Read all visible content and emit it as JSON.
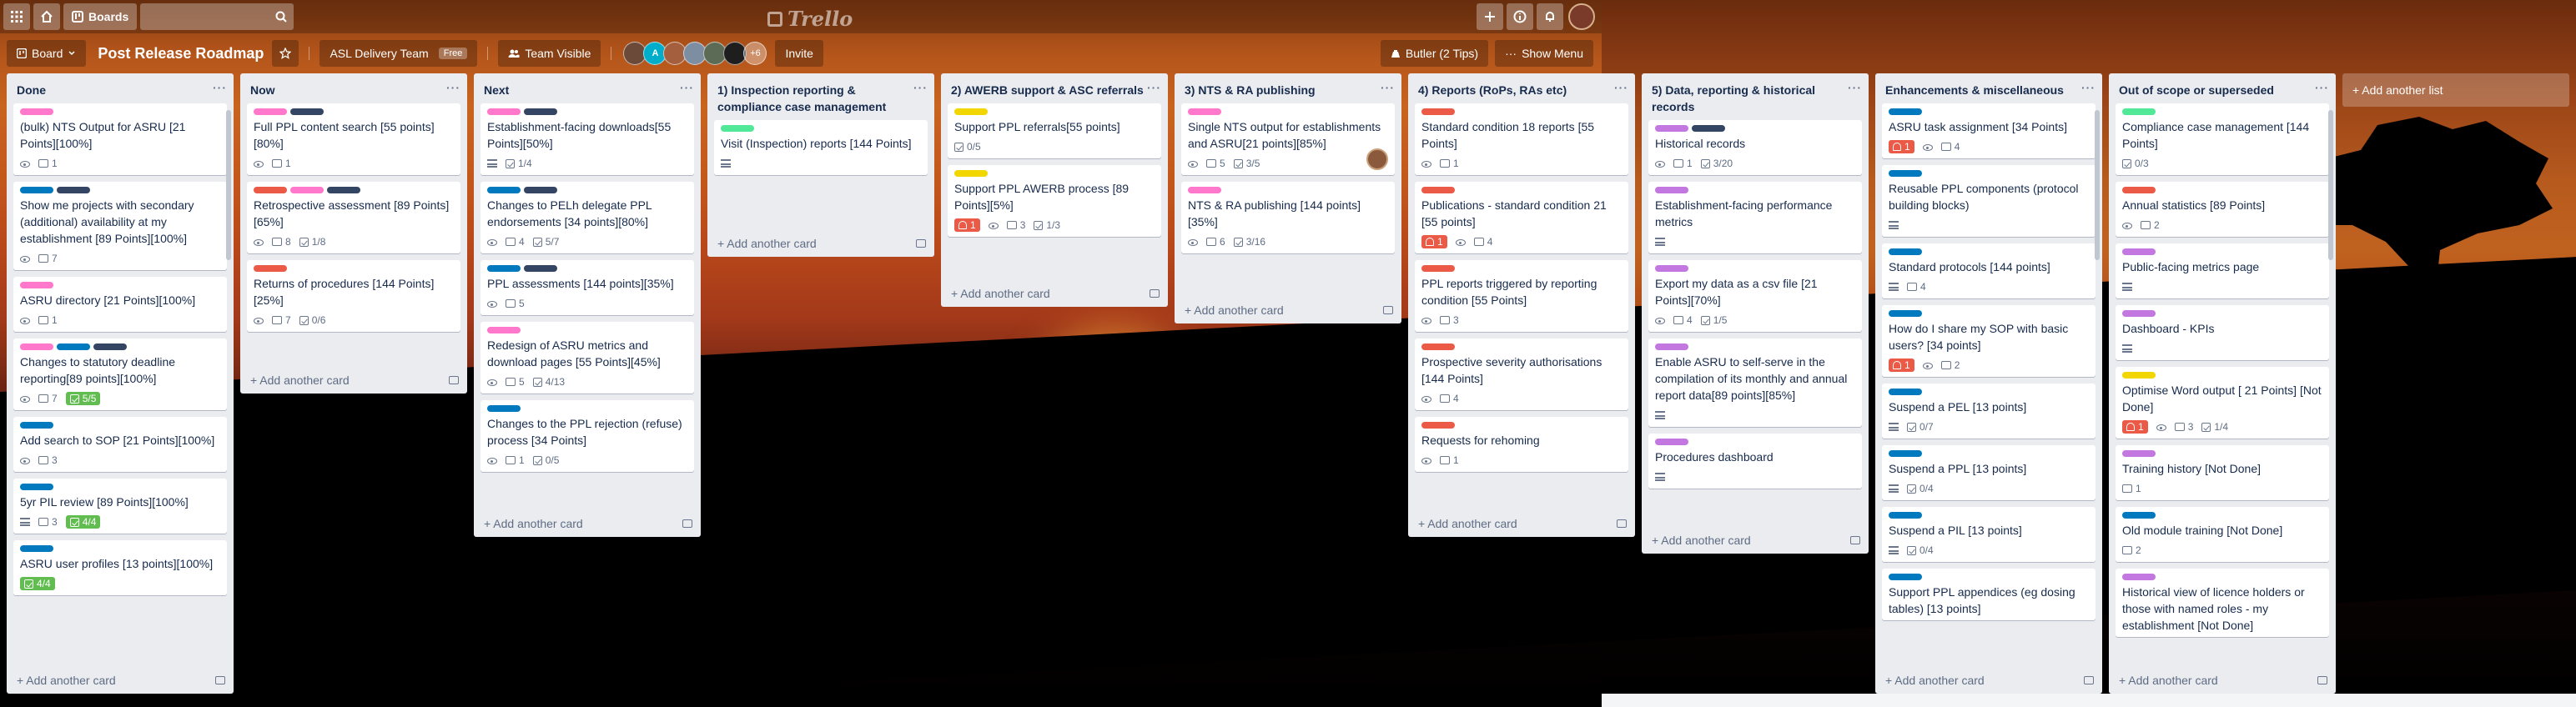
{
  "header": {
    "boards_label": "Boards",
    "search_placeholder": "",
    "logo_text": "Trello",
    "icons": [
      "apps-icon",
      "home-icon",
      "boards-icon",
      "search-icon",
      "plus-icon",
      "info-icon",
      "bell-icon"
    ]
  },
  "board": {
    "board_switcher": "Board",
    "title": "Post Release Roadmap",
    "team": "ASL Delivery Team",
    "team_badge": "Free",
    "visibility": "Team Visible",
    "member_overflow": "+6",
    "invite": "Invite",
    "butler": "Butler (2 Tips)",
    "show_menu": "Show Menu"
  },
  "colors": {
    "pink": "#ff78cb",
    "navy": "#344563",
    "blue": "#0079bf",
    "red": "#eb5a46",
    "green": "#61bd4f",
    "yellow": "#f2d600",
    "purple": "#c377e0",
    "lime": "#51e898"
  },
  "add_card_label": "Add another card",
  "add_list_label": "Add another list",
  "lists": [
    {
      "title": "Done",
      "cards": [
        {
          "labels": [
            "pink"
          ],
          "title": "(bulk) NTS Output for ASRU [21 Points][100%]",
          "watch": true,
          "comments": "1"
        },
        {
          "labels": [
            "blue",
            "navy"
          ],
          "title": "Show me projects with secondary (additional) availability at my establishment [89 Points][100%]",
          "watch": true,
          "comments": "7"
        },
        {
          "labels": [
            "pink"
          ],
          "title": "ASRU directory [21 Points][100%]",
          "watch": true,
          "comments": "1"
        },
        {
          "labels": [
            "pink",
            "blue",
            "navy"
          ],
          "title": "Changes to statutory deadline reporting[89 points][100%]",
          "watch": true,
          "comments": "7",
          "checklist": "5/5",
          "complete": true
        },
        {
          "labels": [
            "blue"
          ],
          "title": "Add search to SOP [21 Points][100%]",
          "watch": true,
          "comments": "3"
        },
        {
          "labels": [
            "blue"
          ],
          "title": "5yr PIL review [89 Points][100%]",
          "desc": true,
          "comments": "3",
          "checklist": "4/4",
          "complete": true
        },
        {
          "labels": [
            "blue"
          ],
          "title": "ASRU user profiles [13 points][100%]",
          "checklist": "4/4",
          "complete": true
        }
      ]
    },
    {
      "title": "Now",
      "cards": [
        {
          "labels": [
            "pink",
            "navy"
          ],
          "title": "Full PPL content search [55 points][80%]",
          "watch": true,
          "comments": "1"
        },
        {
          "labels": [
            "red",
            "pink",
            "navy"
          ],
          "title": "Retrospective assessment [89 Points][65%]",
          "watch": true,
          "comments": "8",
          "checklist": "1/8"
        },
        {
          "labels": [
            "red"
          ],
          "title": "Returns of procedures [144 Points][25%]",
          "watch": true,
          "comments": "7",
          "checklist": "0/6"
        }
      ]
    },
    {
      "title": "Next",
      "cards": [
        {
          "labels": [
            "pink",
            "navy"
          ],
          "title": "Establishment-facing downloads[55 Points][50%]",
          "desc": true,
          "checklist": "1/4"
        },
        {
          "labels": [
            "blue",
            "navy"
          ],
          "title": "Changes to PELh delegate PPL endorsements [34 points][80%]",
          "watch": true,
          "comments": "4",
          "checklist": "5/7"
        },
        {
          "labels": [
            "blue",
            "navy"
          ],
          "title": "PPL assessments [144 points][35%]",
          "watch": true,
          "comments": "5"
        },
        {
          "labels": [
            "pink"
          ],
          "title": "Redesign of ASRU metrics and download pages [55 Points][45%]",
          "watch": true,
          "comments": "5",
          "checklist": "4/13"
        },
        {
          "labels": [
            "blue"
          ],
          "title": "Changes to the PPL rejection (refuse) process [34 Points]",
          "watch": true,
          "comments": "1",
          "checklist": "0/5"
        }
      ]
    },
    {
      "title": "1) Inspection reporting & compliance case management",
      "cards": [
        {
          "labels": [
            "lime"
          ],
          "title": "Visit (Inspection) reports [144 Points]",
          "desc": true
        }
      ]
    },
    {
      "title": "2) AWERB support & ASC referrals",
      "cards": [
        {
          "labels": [
            "yellow"
          ],
          "title": "Support PPL referrals[55 points]",
          "checklist": "0/5"
        },
        {
          "labels": [
            "yellow"
          ],
          "title": "Support PPL AWERB process [89 Points][5%]",
          "due": "1",
          "watch": true,
          "comments": "3",
          "checklist": "1/3"
        }
      ]
    },
    {
      "title": "3) NTS & RA publishing",
      "cards": [
        {
          "labels": [
            "pink"
          ],
          "title": "Single NTS output for establishments and ASRU[21 points][85%]",
          "watch": true,
          "comments": "5",
          "checklist": "3/5",
          "avatar": true
        },
        {
          "labels": [
            "pink"
          ],
          "title": "NTS & RA publishing [144 points][35%]",
          "watch": true,
          "comments": "6",
          "checklist": "3/16"
        }
      ]
    },
    {
      "title": "4) Reports (RoPs, RAs etc)",
      "cards": [
        {
          "labels": [
            "red"
          ],
          "title": "Standard condition 18 reports [55 Points]",
          "watch": true,
          "comments": "1"
        },
        {
          "labels": [
            "red"
          ],
          "title": "Publications - standard condition 21 [55 points]",
          "due": "1",
          "watch": true,
          "comments": "4"
        },
        {
          "labels": [
            "red"
          ],
          "title": "PPL reports triggered by reporting condition [55 Points]",
          "watch": true,
          "comments": "3"
        },
        {
          "labels": [
            "red"
          ],
          "title": "Prospective severity authorisations [144 Points]",
          "watch": true,
          "comments": "4"
        },
        {
          "labels": [
            "red"
          ],
          "title": "Requests for rehoming",
          "watch": true,
          "comments": "1"
        }
      ]
    },
    {
      "title": "5) Data, reporting & historical records",
      "cards": [
        {
          "labels": [
            "purple",
            "navy"
          ],
          "title": "Historical records",
          "watch": true,
          "comments": "1",
          "checklist": "3/20"
        },
        {
          "labels": [
            "purple"
          ],
          "title": "Establishment-facing performance metrics",
          "desc": true
        },
        {
          "labels": [
            "purple"
          ],
          "title": "Export my data as a csv file [21 Points][70%]",
          "watch": true,
          "comments": "4",
          "checklist": "1/5"
        },
        {
          "labels": [
            "purple"
          ],
          "title": "Enable ASRU to self-serve in the compilation of its monthly and annual report data[89 points][85%]",
          "desc": true
        },
        {
          "labels": [
            "purple"
          ],
          "title": "Procedures dashboard",
          "desc": true
        }
      ]
    },
    {
      "title": "Enhancements & miscellaneous",
      "cards": [
        {
          "labels": [
            "blue"
          ],
          "title": "ASRU task assignment [34 Points]",
          "due": "1",
          "watch": true,
          "comments": "4"
        },
        {
          "labels": [
            "blue"
          ],
          "title": "Reusable PPL components (protocol building blocks)",
          "desc": true
        },
        {
          "labels": [
            "blue"
          ],
          "title": "Standard protocols [144 points]",
          "desc": true,
          "comments": "4"
        },
        {
          "labels": [
            "blue"
          ],
          "title": "How do I share my SOP with basic users? [34 points]",
          "due": "1",
          "watch": true,
          "comments": "2"
        },
        {
          "labels": [
            "blue"
          ],
          "title": "Suspend a PEL [13 points]",
          "desc": true,
          "checklist": "0/7"
        },
        {
          "labels": [
            "blue"
          ],
          "title": "Suspend a PPL [13 points]",
          "desc": true,
          "checklist": "0/4"
        },
        {
          "labels": [
            "blue"
          ],
          "title": "Suspend a PIL [13 points]",
          "desc": true,
          "checklist": "0/4"
        },
        {
          "labels": [
            "blue"
          ],
          "title": "Support PPL appendices (eg dosing tables) [13 points]"
        }
      ]
    },
    {
      "title": "Out of scope or superseded",
      "cards": [
        {
          "labels": [
            "lime"
          ],
          "title": "Compliance case management [144 Points]",
          "checklist": "0/3"
        },
        {
          "labels": [
            "red"
          ],
          "title": "Annual statistics [89 Points]",
          "watch": true,
          "comments": "2"
        },
        {
          "labels": [
            "purple"
          ],
          "title": "Public-facing metrics page",
          "desc": true
        },
        {
          "labels": [
            "purple"
          ],
          "title": "Dashboard - KPIs",
          "desc": true
        },
        {
          "labels": [
            "yellow"
          ],
          "title": "Optimise Word output [ 21 Points] [Not Done]",
          "due": "1",
          "watch": true,
          "comments": "3",
          "checklist": "1/4"
        },
        {
          "labels": [
            "purple"
          ],
          "title": "Training history [Not Done]",
          "comments": "1"
        },
        {
          "labels": [
            "blue"
          ],
          "title": "Old module training [Not Done]",
          "comments": "2"
        },
        {
          "labels": [
            "purple"
          ],
          "title": "Historical view of licence holders or those with named roles - my establishment [Not Done]"
        }
      ]
    }
  ]
}
